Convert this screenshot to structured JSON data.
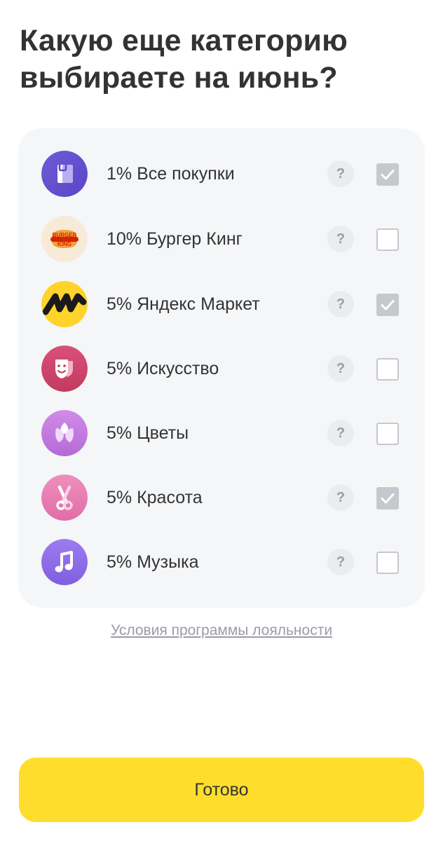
{
  "title": "Какую еще категорию выбираете на июнь?",
  "categories": [
    {
      "label": "1% Все покупки",
      "icon": "shopping-bag-icon",
      "checked": true
    },
    {
      "label": "10% Бургер Кинг",
      "icon": "burger-king-logo-icon",
      "checked": false,
      "logo_text": "BURGER KING"
    },
    {
      "label": "5% Яндекс Маркет",
      "icon": "yandex-market-logo-icon",
      "checked": true
    },
    {
      "label": "5% Искусство",
      "icon": "theater-masks-icon",
      "checked": false
    },
    {
      "label": "5% Цветы",
      "icon": "flower-icon",
      "checked": false
    },
    {
      "label": "5% Красота",
      "icon": "scissors-icon",
      "checked": true
    },
    {
      "label": "5% Музыка",
      "icon": "music-note-icon",
      "checked": false
    }
  ],
  "info_label": "?",
  "terms_link": "Условия программы лояльности",
  "done_button": "Готово",
  "colors": {
    "accent": "#ffdd2d",
    "card_bg": "#f5f6f8",
    "text": "#333333",
    "muted": "#9a9ca4",
    "checkbox": "#c6c8ce"
  }
}
